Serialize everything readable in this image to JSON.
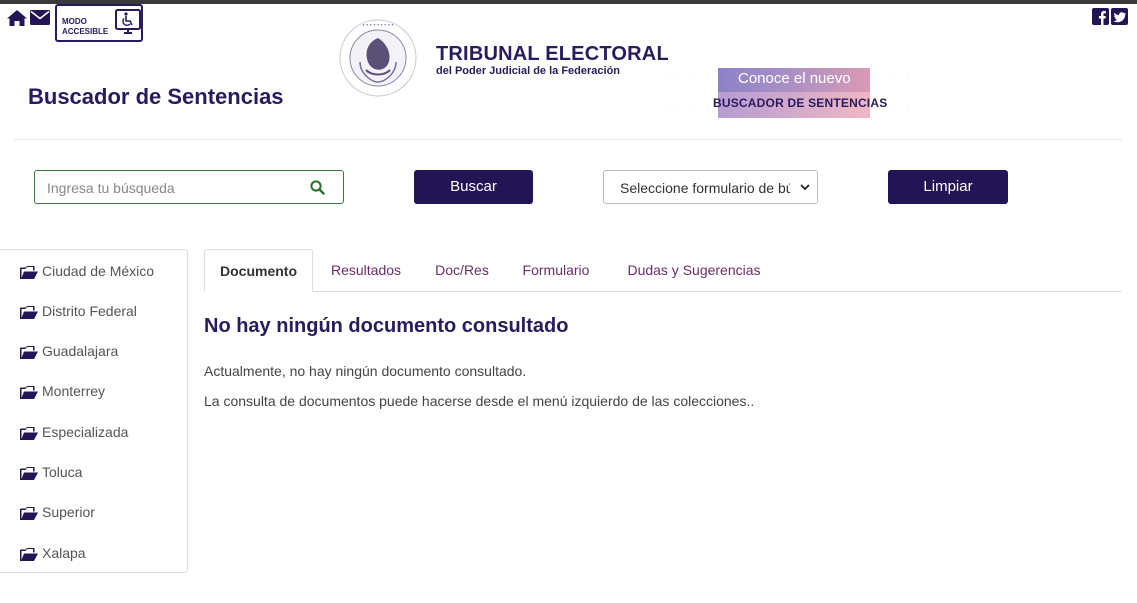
{
  "header": {
    "accessible_mode": "MODO\nACCESIBLE",
    "org_title": "TRIBUNAL ELECTORAL",
    "org_subtitle": "del Poder Judicial de la Federación",
    "page_title": "Buscador de Sentencias",
    "banner": {
      "line1": "Conoce el nuevo",
      "line2": "BUSCADOR DE SENTENCIAS"
    }
  },
  "search": {
    "placeholder": "Ingresa tu búsqueda",
    "search_button": "Buscar",
    "form_select": "Seleccione formulario de bú",
    "clear_button": "Limpiar"
  },
  "sidebar": {
    "items": [
      {
        "label": "Ciudad de México"
      },
      {
        "label": "Distrito Federal"
      },
      {
        "label": "Guadalajara"
      },
      {
        "label": "Monterrey"
      },
      {
        "label": "Especializada"
      },
      {
        "label": "Toluca"
      },
      {
        "label": "Superior"
      },
      {
        "label": "Xalapa"
      }
    ]
  },
  "tabs": [
    {
      "label": "Documento",
      "active": true
    },
    {
      "label": "Resultados"
    },
    {
      "label": "Doc/Res"
    },
    {
      "label": "Formulario"
    },
    {
      "label": "Dudas y Sugerencias"
    }
  ],
  "content": {
    "heading": "No hay ningún documento consultado",
    "paragraph1": "Actualmente, no hay ningún documento consultado.",
    "paragraph2": "La consulta de documentos puede hacerse desde el menú izquierdo de las colecciones.."
  },
  "colors": {
    "primary": "#231456",
    "tab_link": "#6b2d6b",
    "search_border": "#3a7a3a"
  },
  "icons": [
    "home-icon",
    "mail-icon",
    "wheelchair-monitor-icon",
    "facebook-icon",
    "twitter-icon",
    "search-icon",
    "folder-open-icon",
    "chevron-down-icon"
  ]
}
